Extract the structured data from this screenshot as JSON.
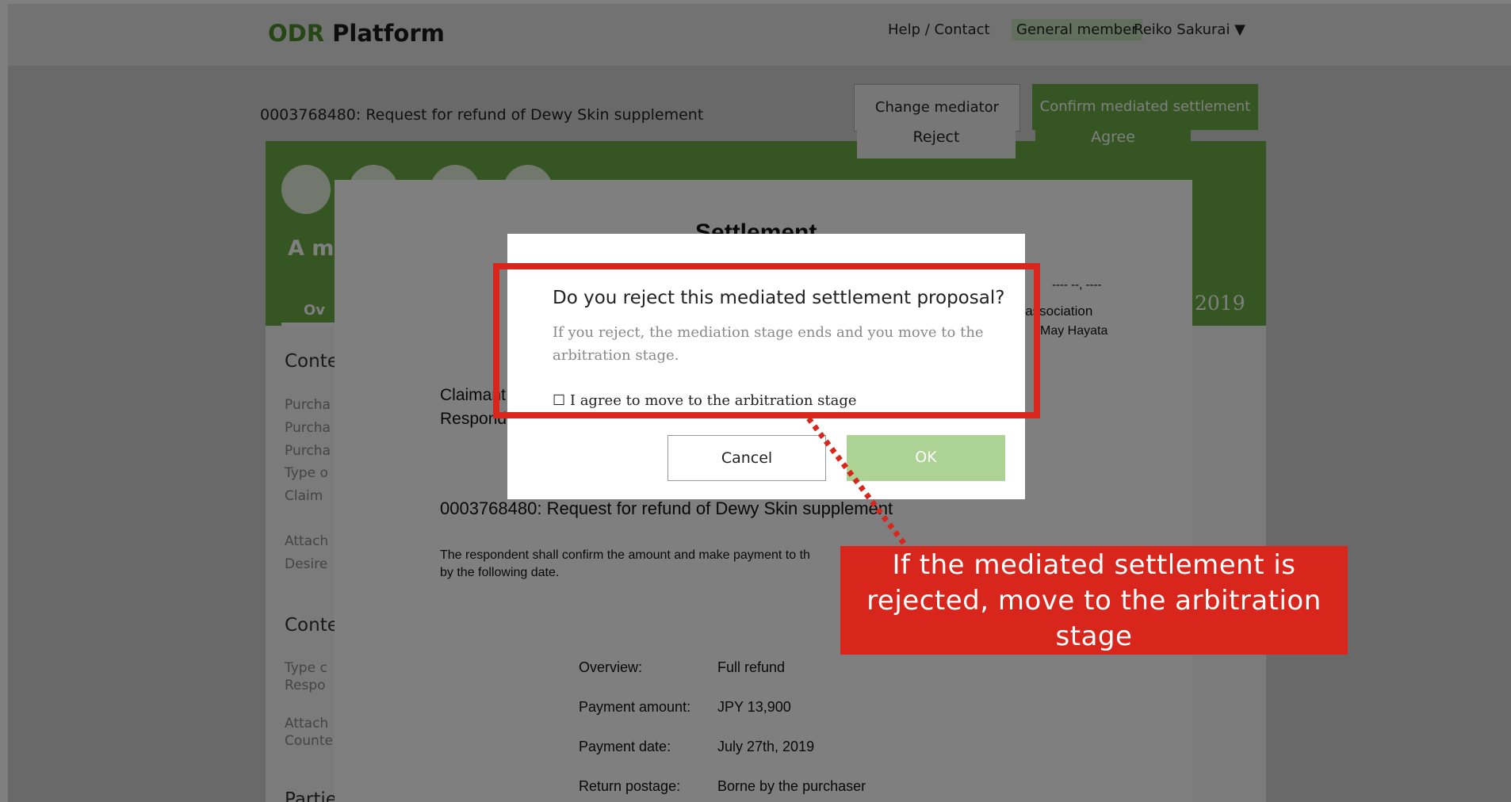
{
  "header": {
    "logo_accent": "ODR",
    "logo_rest": " Platform",
    "help_link": "Help / Contact",
    "member_badge": "General member",
    "user_name": "Reiko Sakurai ▼"
  },
  "case": {
    "title": "0003768480: Request for refund of Dewy Skin supplement",
    "change_mediator_label": "Change mediator",
    "confirm_settlement_label": "Confirm mediated settlement"
  },
  "band": {
    "heading": "A m",
    "tab_label": "Ov",
    "year": "2019"
  },
  "panel": {
    "section1": "Conte",
    "section1_rows": [
      "Purcha",
      "Purcha",
      "Purcha",
      "Type o",
      "Claim"
    ],
    "attach_rows": [
      "Attach",
      "Desire"
    ],
    "section2": "Conte",
    "section2_rows": [
      "Type c",
      "Respo"
    ],
    "section2_attach": [
      "Attach",
      "Counte"
    ],
    "section3": "Partie"
  },
  "settlement_doc": {
    "title": "Settlement",
    "date": "---- --, ----",
    "association": "x association",
    "signer": "May Hayata",
    "claimant": "Claimant",
    "respondent": "Respondent",
    "case_line": "0003768480: Request for refund of Dewy Skin supplement",
    "body_line1": "The respondent shall confirm the amount and make payment to th",
    "body_line2": "by the following date.",
    "rows": [
      {
        "label": "Overview:",
        "value": "Full refund"
      },
      {
        "label": "Payment amount:",
        "value": "JPY 13,900"
      },
      {
        "label": "Payment date:",
        "value": "July 27th, 2019"
      },
      {
        "label": "Return postage:",
        "value": "Borne by the purchaser"
      }
    ]
  },
  "decision_buttons": {
    "reject": "Reject",
    "agree": "Agree"
  },
  "modal": {
    "question": "Do you reject this mediated settlement proposal?",
    "info_line1": "If you reject, the mediation stage ends and you move to the",
    "info_line2": "arbitration stage.",
    "checkbox_label": "☐ I agree to move to the arbitration stage",
    "cancel": "Cancel",
    "ok": "OK"
  },
  "annotation": {
    "callout_line1": "If the mediated settlement is",
    "callout_line2": "rejected, move to the arbitration",
    "callout_line3": "stage"
  },
  "colors": {
    "brand_green": "#6aab45",
    "ok_disabled_green": "#acd294",
    "annotation_red": "#d9261c"
  }
}
